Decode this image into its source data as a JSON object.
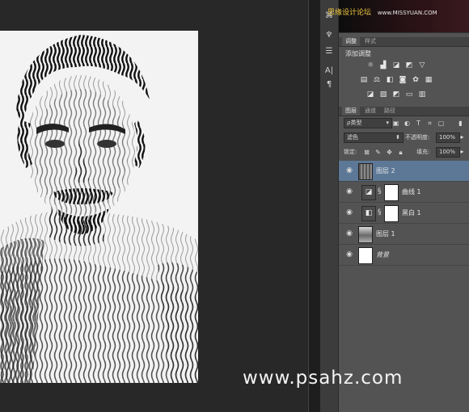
{
  "watermark": {
    "site_cn": "思缘设计论坛",
    "site_url": "www.MISSYUAN.COM"
  },
  "footer_watermark": "www.psahz.com",
  "adjustments_panel": {
    "tabs": [
      {
        "label": "调整",
        "active": true
      },
      {
        "label": "样式",
        "active": false
      }
    ],
    "title": "添加调整",
    "icons_row1": [
      "brightness-icon",
      "levels-icon",
      "curves-icon",
      "exposure-icon",
      "vibrance-icon"
    ],
    "icons_row2": [
      "hue-saturation-icon",
      "color-balance-icon",
      "black-white-icon",
      "photo-filter-icon",
      "channel-mixer-icon",
      "color-lookup-icon"
    ],
    "icons_row3": [
      "invert-icon",
      "posterize-icon",
      "threshold-icon",
      "gradient-map-icon",
      "selective-color-icon"
    ]
  },
  "layers_panel": {
    "tabs": [
      {
        "label": "图层",
        "active": true
      },
      {
        "label": "通道",
        "active": false
      },
      {
        "label": "路径",
        "active": false
      }
    ],
    "filter_kind": "ρ类型",
    "blend_mode": "滤色",
    "opacity_label": "不透明度:",
    "opacity_value": "100%",
    "lock_label": "锁定:",
    "fill_label": "填充:",
    "fill_value": "100%",
    "layers": [
      {
        "name": "图层 2",
        "type": "pixel",
        "selected": true
      },
      {
        "name": "曲线 1",
        "type": "curves-adjustment",
        "selected": false
      },
      {
        "name": "黑白 1",
        "type": "black-white-adjustment",
        "selected": false
      },
      {
        "name": "图层 1",
        "type": "photo",
        "selected": false
      },
      {
        "name": "背景",
        "type": "background",
        "selected": false
      }
    ]
  },
  "colors": {
    "selected_layer": "#5c7896",
    "panel_bg": "#535353",
    "canvas_bg": "#282828"
  }
}
